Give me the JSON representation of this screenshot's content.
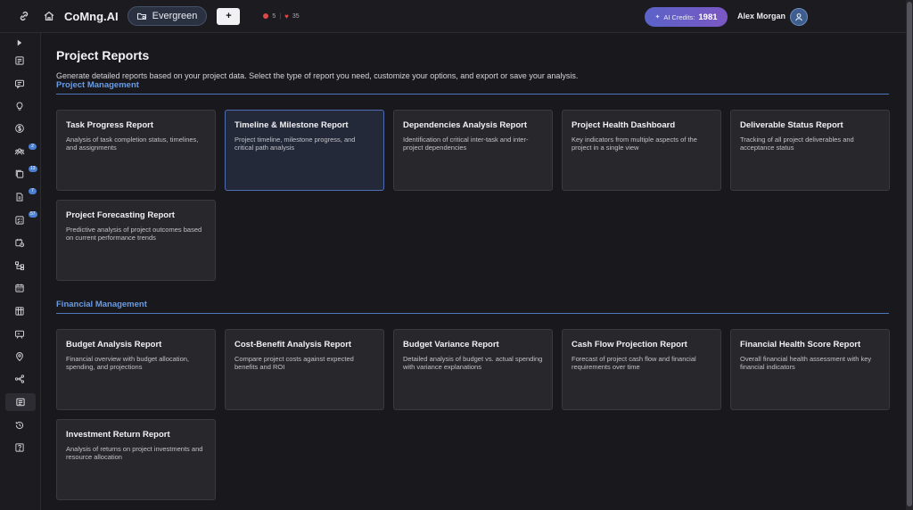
{
  "app": {
    "brand": "CoMng.AI",
    "project": "Evergreen",
    "add_label": "+",
    "stat_alerts": "5",
    "stat_separator": "|",
    "stat_likes": "35",
    "credits_label": "AI Credits:",
    "credits_value": "1981",
    "user_name": "Alex Morgan"
  },
  "icons": {
    "link": "link-icon",
    "home": "home-icon",
    "folder": "folder-icon",
    "user": "user-icon"
  },
  "sidebar": {
    "items": [
      {
        "icon": "expand-arrow-icon"
      },
      {
        "icon": "task-list-icon"
      },
      {
        "icon": "chat-icon"
      },
      {
        "icon": "lightbulb-icon"
      },
      {
        "icon": "currency-icon"
      },
      {
        "icon": "team-icon",
        "badge": "2"
      },
      {
        "icon": "documents-icon",
        "badge": "13"
      },
      {
        "icon": "file-icon",
        "badge": "7"
      },
      {
        "icon": "checklist-icon",
        "badge": "57"
      },
      {
        "icon": "calendar-clock-icon"
      },
      {
        "icon": "hierarchy-icon"
      },
      {
        "icon": "calendar-icon"
      },
      {
        "icon": "board-icon"
      },
      {
        "icon": "presentation-icon"
      },
      {
        "icon": "location-icon"
      },
      {
        "icon": "network-icon"
      },
      {
        "icon": "reports-icon",
        "active": true
      },
      {
        "icon": "history-icon"
      },
      {
        "icon": "help-icon"
      }
    ]
  },
  "page": {
    "title": "Project Reports",
    "description": "Generate detailed reports based on your project data. Select the type of report you need, customize your options, and export or save your analysis."
  },
  "sections": [
    {
      "title": "Project Management",
      "cards": [
        {
          "title": "Task Progress Report",
          "desc": "Analysis of task completion status, timelines, and assignments"
        },
        {
          "title": "Timeline & Milestone Report",
          "desc": "Project timeline, milestone progress, and critical path analysis",
          "active": true
        },
        {
          "title": "Dependencies Analysis Report",
          "desc": "Identification of critical inter-task and inter-project dependencies"
        },
        {
          "title": "Project Health Dashboard",
          "desc": "Key indicators from multiple aspects of the project in a single view"
        },
        {
          "title": "Deliverable Status Report",
          "desc": "Tracking of all project deliverables and acceptance status"
        },
        {
          "title": "Project Forecasting Report",
          "desc": "Predictive analysis of project outcomes based on current performance trends"
        }
      ]
    },
    {
      "title": "Financial Management",
      "cards": [
        {
          "title": "Budget Analysis Report",
          "desc": "Financial overview with budget allocation, spending, and projections"
        },
        {
          "title": "Cost-Benefit Analysis Report",
          "desc": "Compare project costs against expected benefits and ROI"
        },
        {
          "title": "Budget Variance Report",
          "desc": "Detailed analysis of budget vs. actual spending with variance explanations"
        },
        {
          "title": "Cash Flow Projection Report",
          "desc": "Forecast of project cash flow and financial requirements over time"
        },
        {
          "title": "Financial Health Score Report",
          "desc": "Overall financial health assessment with key financial indicators"
        },
        {
          "title": "Investment Return Report",
          "desc": "Analysis of returns on project investments and resource allocation"
        }
      ]
    }
  ],
  "colors": {
    "accent": "#6a9ce4",
    "credits_gradient_start": "#5a63c8",
    "credits_gradient_end": "#7b57c4",
    "alert": "#e04848"
  }
}
